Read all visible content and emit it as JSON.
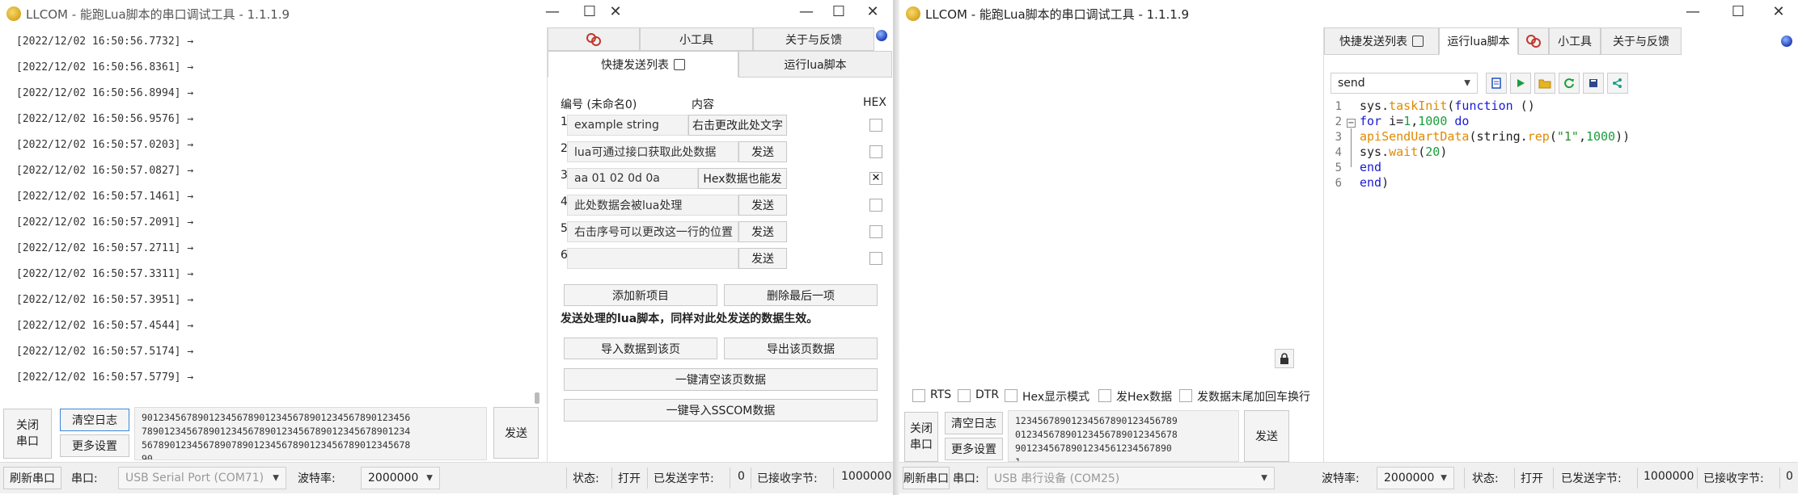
{
  "left_window": {
    "title": "LLCOM - 能跑Lua脚本的串口调试工具 - 1.1.1.9",
    "log_lines": [
      "[2022/12/02 16:50:56.7732] →",
      "[2022/12/02 16:50:56.8361] →",
      "[2022/12/02 16:50:56.8994] →",
      "[2022/12/02 16:50:56.9576] →",
      "[2022/12/02 16:50:57.0203] →",
      "[2022/12/02 16:50:57.0827] →",
      "[2022/12/02 16:50:57.1461] →",
      "[2022/12/02 16:50:57.2091] →",
      "[2022/12/02 16:50:57.2711] →",
      "[2022/12/02 16:50:57.3311] →",
      "[2022/12/02 16:50:57.3951] →",
      "[2022/12/02 16:50:57.4544] →",
      "[2022/12/02 16:50:57.5174] →",
      "[2022/12/02 16:50:57.5779] →"
    ],
    "tabs_top": [
      "小工具",
      "关于与反馈"
    ],
    "tabs_second": [
      "快捷发送列表",
      "运行lua脚本"
    ],
    "quick_header": {
      "num": "编号 (未命名0)",
      "content": "内容",
      "hex": "HEX"
    },
    "quick_rows": [
      {
        "num": "1",
        "text": "example string",
        "btn": "右击更改此处文字",
        "hex": ""
      },
      {
        "num": "2",
        "text": "lua可通过接口获取此处数据",
        "btn": "发送",
        "hex": ""
      },
      {
        "num": "3",
        "text": "aa 01 02 0d 0a",
        "btn": "Hex数据也能发",
        "hex": "✕"
      },
      {
        "num": "4",
        "text": "此处数据会被lua处理",
        "btn": "发送",
        "hex": ""
      },
      {
        "num": "5",
        "text": "右击序号可以更改这一行的位置",
        "btn": "发送",
        "hex": ""
      },
      {
        "num": "6",
        "text": "",
        "btn": "发送",
        "hex": ""
      }
    ],
    "add_item": "添加新项目",
    "delete_last": "删除最后一项",
    "note": "发送处理的lua脚本，同样对此处发送的数据生效。",
    "import_page": "导入数据到该页",
    "export_page": "导出该页数据",
    "clear_page": "一键清空该页数据",
    "import_sscom": "一键导入SSCOM数据",
    "close_port_line1": "关闭",
    "close_port_line2": "串口",
    "clear_log": "清空日志",
    "more_settings": "更多设置",
    "send_text": "901234567890123456789012345678901234567890123456\n789012345678901234567890123456789012345678901234\n567890123456789078901234567890123456789012345678\n90",
    "send": "发送",
    "status": {
      "refresh": "刷新串口",
      "port_label": "串口:",
      "port_value": "USB Serial Port (COM71)",
      "baud_label": "波特率:",
      "baud_value": "2000000",
      "state_label": "状态:",
      "state_value": "打开",
      "sent_label": "已发送字节:",
      "sent_value": "0",
      "recv_label": "已接收字节:",
      "recv_value": "1000000"
    }
  },
  "right_window": {
    "title": "LLCOM - 能跑Lua脚本的串口调试工具 - 1.1.1.9",
    "tabs": [
      "快捷发送列表",
      "运行lua脚本",
      "小工具",
      "关于与反馈"
    ],
    "script_select": "send",
    "code_lines": [
      "1",
      "2",
      "3",
      "4",
      "5",
      "6"
    ],
    "checkboxes": [
      "RTS",
      "DTR",
      "Hex显示模式",
      "发Hex数据",
      "发数据末尾加回车换行"
    ],
    "close_port_line1": "关闭",
    "close_port_line2": "串口",
    "clear_log": "清空日志",
    "more_settings": "更多设置",
    "send_text": "12345678901234567890123456789\n01234567890123456789012345678\n9012345678901234561234567890\n1",
    "send": "发送",
    "status": {
      "refresh": "刷新串口",
      "port_label": "串口:",
      "port_value": "USB 串行设备 (COM25)",
      "baud_label": "波特率:",
      "baud_value": "2000000",
      "state_label": "状态:",
      "state_value": "打开",
      "sent_label": "已发送字节:",
      "sent_value": "1000000",
      "recv_label": "已接收字节:",
      "recv_value": "0"
    }
  },
  "window_controls": {
    "minimize": "—",
    "maximize": "☐",
    "close": "✕"
  },
  "colors": {
    "play": "#1a9e3c",
    "folder": "#d9a520",
    "refresh": "#1a9e3c",
    "accent": "#0a64d6"
  }
}
